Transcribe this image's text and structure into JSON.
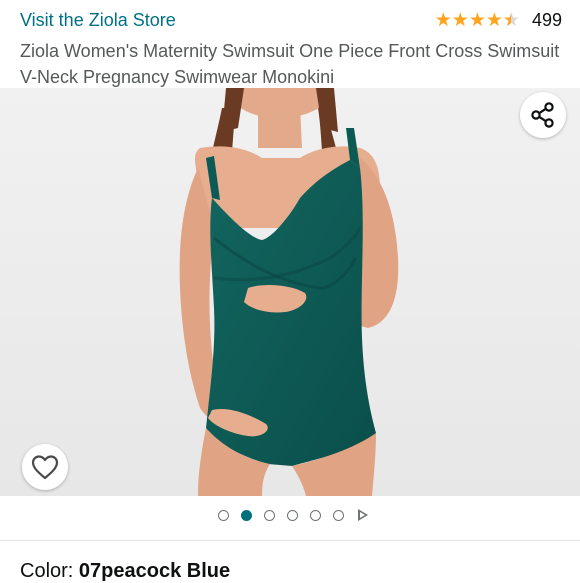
{
  "header": {
    "store_link": "Visit the Ziola Store",
    "rating_stars": 4.5,
    "review_count": "499"
  },
  "product": {
    "title": "Ziola Women's Maternity Swimsuit One Piece Front Cross Swimsuit V-Neck Pregnancy Swimwear Monokini"
  },
  "gallery": {
    "image_count": 6,
    "active_index": 1,
    "share_icon": "share-icon",
    "favorite_icon": "heart-icon",
    "video_icon": "play-icon"
  },
  "color": {
    "label": "Color: ",
    "value": "07peacock Blue"
  },
  "colors": {
    "accent": "#007185",
    "star": "#ffa41c",
    "swimsuit": "#0c5a55"
  }
}
